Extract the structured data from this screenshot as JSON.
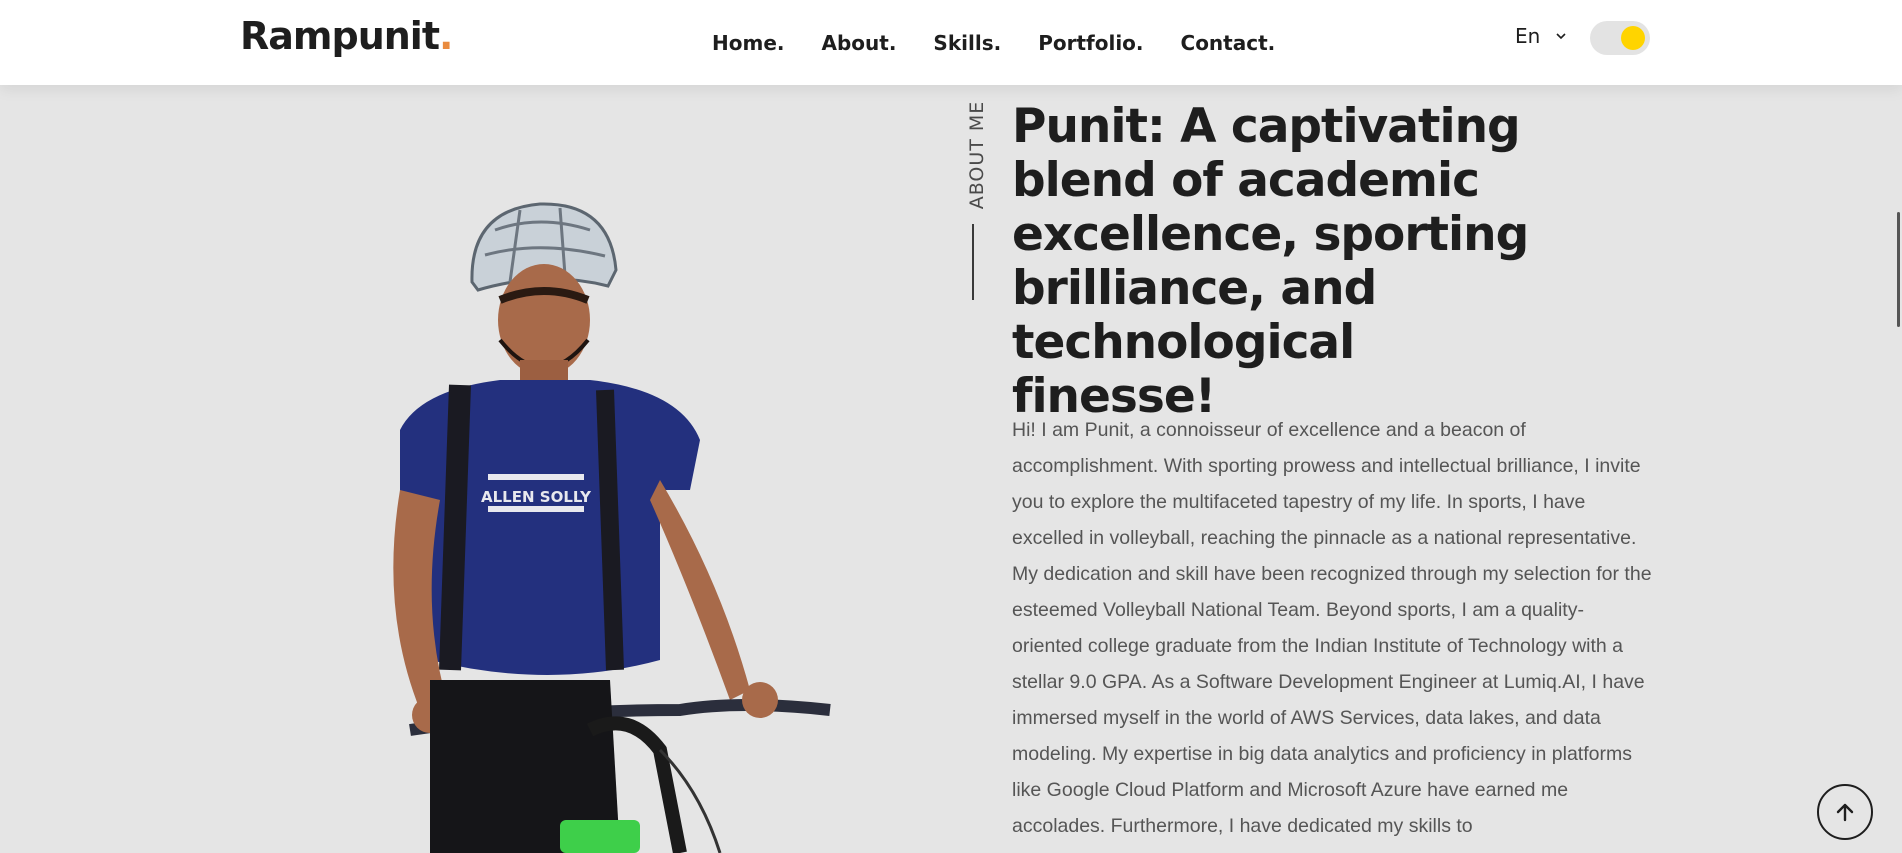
{
  "header": {
    "logo_text": "Rampunit",
    "logo_dot": ".",
    "nav": [
      {
        "label": "Home."
      },
      {
        "label": "About."
      },
      {
        "label": "Skills."
      },
      {
        "label": "Portfolio."
      },
      {
        "label": "Contact."
      }
    ],
    "language": "En",
    "language_icon": "chevron-down-icon",
    "theme_toggle_icon": "sun-toggle",
    "logo_accent_color": "#e98b3f",
    "toggle_color": "#ffd400"
  },
  "about": {
    "side_label": "ABOUT ME",
    "heading": "Punit: A captivating blend of academic excellence, sporting brilliance, and technological finesse!",
    "bio": "Hi! I am Punit, a connoisseur of excellence and a beacon of accomplishment. With sporting prowess and intellectual brilliance, I invite you to explore the multifaceted tapestry of my life. In sports, I have excelled in volleyball, reaching the pinnacle as a national representative. My dedication and skill have been recognized through my selection for the esteemed Volleyball National Team. Beyond sports, I am a quality-oriented college graduate from the Indian Institute of Technology with a stellar 9.0 GPA. As a Software Development Engineer at Lumiq.AI, I have immersed myself in the world of AWS Services, data lakes, and data modeling. My expertise in big data analytics and proficiency in platforms like Google Cloud Platform and Microsoft Azure have earned me accolades. Furthermore, I have dedicated my skills to",
    "shirt_text": "ALLEN SOLLY"
  },
  "scroll_top_icon": "arrow-up-icon"
}
